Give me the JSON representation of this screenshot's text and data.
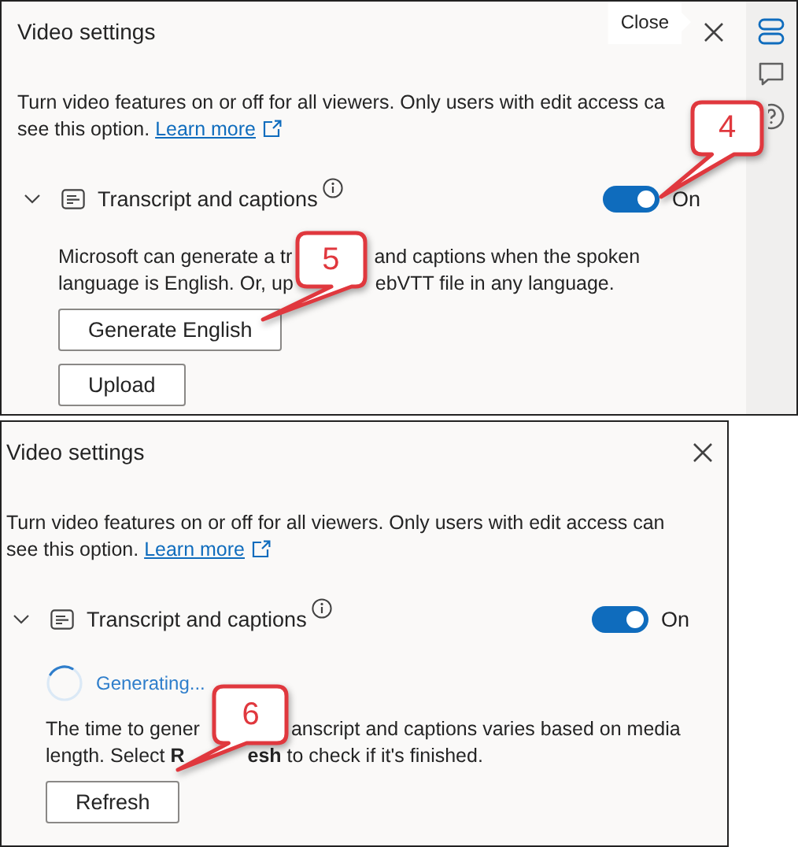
{
  "panels": [
    {
      "title": "Video settings",
      "close_tooltip": "Close",
      "side_rail": [
        {
          "selected": true
        },
        {
          "selected": false
        },
        {
          "selected": false
        }
      ],
      "intro": {
        "lines": [
          "Turn video features on or off for all viewers. Only users with edit access ca",
          "see this option."
        ],
        "link": "Learn more"
      },
      "feature": {
        "title": "Transcript and captions",
        "expanded": true,
        "toggle": {
          "on": true,
          "label": "On",
          "callout": "4"
        }
      },
      "description": {
        "lines": [
          {
            "before": "Microsoft can generate a tr",
            "after": "and captions when the spoken"
          },
          {
            "before": "language is English. Or, up",
            "after": "ebVTT file in any language."
          }
        ],
        "callout": "5"
      },
      "buttons": [
        "Generate English",
        "Upload"
      ]
    },
    {
      "title": "Video settings",
      "intro": {
        "lines": [
          "Turn video features on or off for all viewers. Only users with edit access can",
          "see this option."
        ],
        "link": "Learn more"
      },
      "feature": {
        "title": "Transcript and captions",
        "expanded": true,
        "toggle": {
          "on": true,
          "label": "On"
        }
      },
      "status": {
        "kind": "generating",
        "text": "Generating..."
      },
      "description": {
        "lines": [
          {
            "before": "The time to gener",
            "after": "anscript and captions varies based on media"
          },
          {
            "before": "length. Select **R**",
            "after": "**esh** to check if it's finished."
          }
        ],
        "callout": "6"
      },
      "buttons": [
        "Refresh"
      ]
    }
  ]
}
